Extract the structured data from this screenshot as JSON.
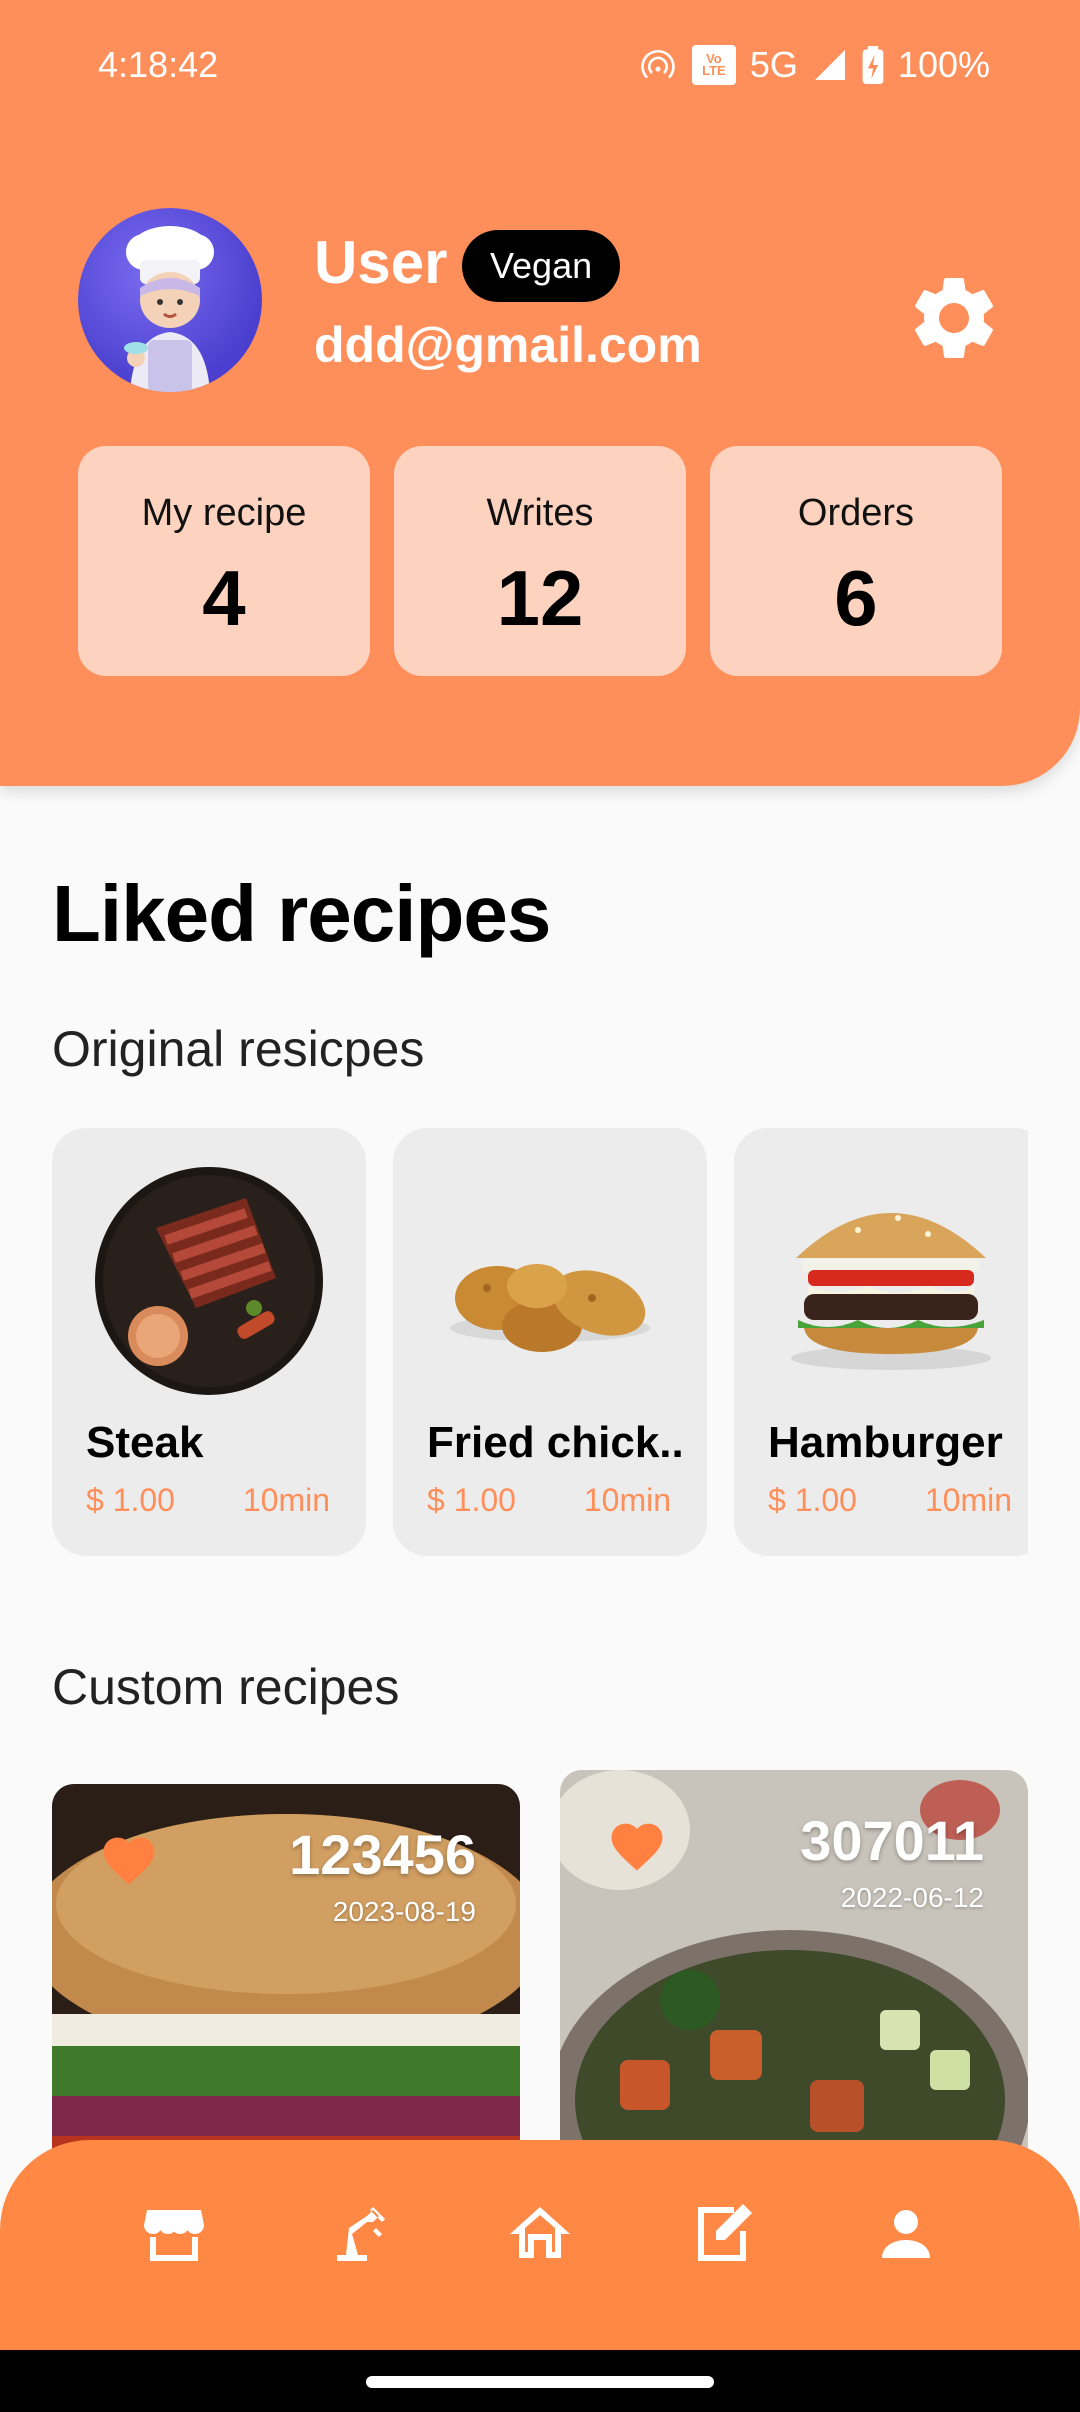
{
  "status_bar": {
    "time": "4:18:42",
    "network": "5G",
    "battery": "100%",
    "volte_top": "Vo",
    "volte_bottom": "LTE"
  },
  "profile": {
    "name": "User",
    "diet": "Vegan",
    "email": "ddd@gmail.com"
  },
  "stats": [
    {
      "label": "My recipe",
      "value": "4"
    },
    {
      "label": "Writes",
      "value": "12"
    },
    {
      "label": "Orders",
      "value": "6"
    }
  ],
  "liked": {
    "title": "Liked recipes",
    "original_title": "Original resicpes",
    "original": [
      {
        "name": "Steak",
        "price": "$ 1.00",
        "time": "10min"
      },
      {
        "name": "Fried chick..",
        "price": "$ 1.00",
        "time": "10min"
      },
      {
        "name": "Hamburger",
        "price": "$ 1.00",
        "time": "10min"
      }
    ],
    "custom_title": "Custom recipes",
    "custom": [
      {
        "id": "123456",
        "date": "2023-08-19"
      },
      {
        "id": "307011",
        "date": "2022-06-12"
      }
    ]
  },
  "nav": [
    {
      "icon": "store-icon"
    },
    {
      "icon": "robot-arm-icon"
    },
    {
      "icon": "home-icon"
    },
    {
      "icon": "edit-note-icon"
    },
    {
      "icon": "person-icon"
    }
  ],
  "colors": {
    "accent": "#ff8f5a",
    "stat_card": "#fdd3c0",
    "nav": "#ff8845"
  }
}
